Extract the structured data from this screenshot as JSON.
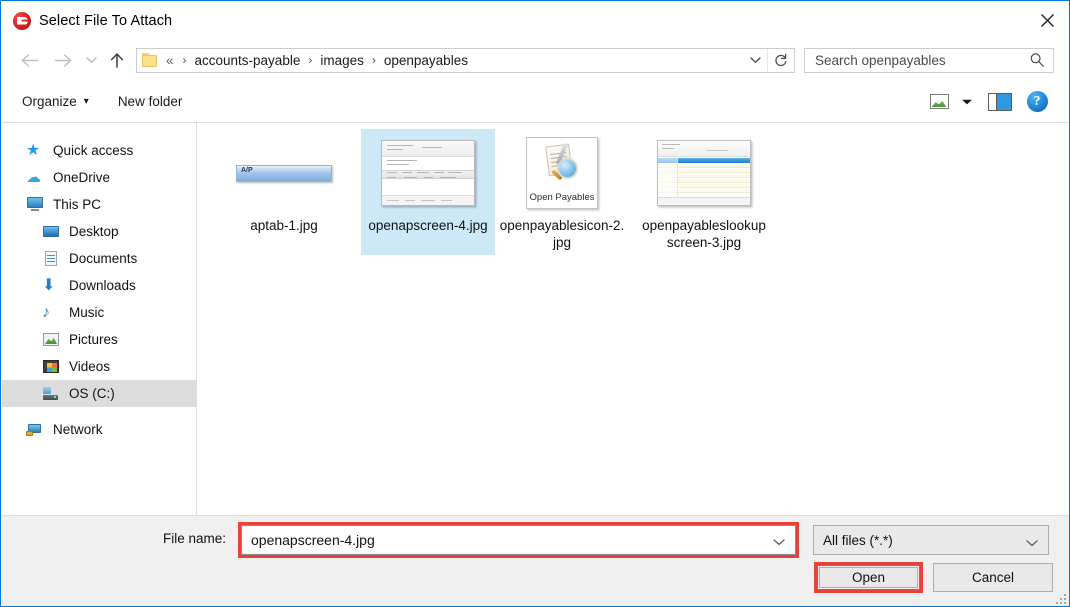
{
  "window": {
    "title": "Select File To Attach",
    "icon": "app-logo-icon",
    "close_label": "✕"
  },
  "navigation": {
    "back_icon": "arrow-left-icon",
    "forward_icon": "arrow-right-icon",
    "recent_icon": "chevron-down-icon",
    "up_icon": "arrow-up-icon",
    "breadcrumb": {
      "folder_icon": "folder-icon",
      "prefix": "«",
      "items": [
        "accounts-payable",
        "images",
        "openpayables"
      ],
      "separator": "›"
    },
    "address_dropdown_icon": "chevron-down-icon",
    "refresh_icon": "refresh-icon"
  },
  "search": {
    "placeholder": "Search openpayables",
    "value": "",
    "icon": "search-icon"
  },
  "toolbar": {
    "organize_label": "Organize",
    "organize_caret": "▾",
    "new_folder_label": "New folder",
    "view_icon": "view-thumbnails-icon",
    "view_caret_icon": "chevron-down-icon",
    "preview_pane_icon": "preview-pane-icon",
    "help_icon": "help-icon",
    "help_glyph": "?"
  },
  "sidebar": {
    "items": [
      {
        "label": "Quick access",
        "icon": "star-icon",
        "indent": false,
        "selected": false
      },
      {
        "label": "OneDrive",
        "icon": "cloud-icon",
        "indent": false,
        "selected": false
      },
      {
        "label": "This PC",
        "icon": "computer-icon",
        "indent": false,
        "selected": false
      },
      {
        "label": "Desktop",
        "icon": "desktop-icon",
        "indent": true,
        "selected": false
      },
      {
        "label": "Documents",
        "icon": "documents-icon",
        "indent": true,
        "selected": false
      },
      {
        "label": "Downloads",
        "icon": "downloads-icon",
        "indent": true,
        "selected": false
      },
      {
        "label": "Music",
        "icon": "music-icon",
        "indent": true,
        "selected": false
      },
      {
        "label": "Pictures",
        "icon": "pictures-icon",
        "indent": true,
        "selected": false
      },
      {
        "label": "Videos",
        "icon": "videos-icon",
        "indent": true,
        "selected": false
      },
      {
        "label": "OS (C:)",
        "icon": "drive-icon",
        "indent": true,
        "selected": true
      },
      {
        "label": "Network",
        "icon": "network-icon",
        "indent": false,
        "selected": false
      }
    ]
  },
  "files": {
    "items": [
      {
        "name": "aptab-1.jpg",
        "thumb": "ap-tab-strip",
        "thumb_caption": "A/P",
        "selected": false
      },
      {
        "name": "openapscreen-4.jpg",
        "thumb": "screenshot-window",
        "thumb_caption": "",
        "selected": true
      },
      {
        "name": "openpayablesicon-2.jpg",
        "thumb": "open-payables-icon",
        "thumb_caption": "Open Payables",
        "selected": false
      },
      {
        "name": "openpayableslookupscreen-3.jpg",
        "thumb": "lookup-table-screenshot",
        "thumb_caption": "",
        "selected": false
      }
    ]
  },
  "bottom": {
    "filename_label": "File name:",
    "filename_value": "openapscreen-4.jpg",
    "filename_caret_icon": "chevron-down-icon",
    "filetype_value": "All files (*.*)",
    "filetype_caret_icon": "chevron-down-icon",
    "open_label": "Open",
    "cancel_label": "Cancel",
    "resize_grip_icon": "resize-grip-icon"
  },
  "colors": {
    "window_border": "#0078d7",
    "selection_blue": "#cde8f7",
    "sidebar_selection": "#dcdcdc",
    "highlight_red": "#e8423a",
    "focus_blue": "#2d8fd5",
    "bottom_panel": "#f0f0f0"
  }
}
